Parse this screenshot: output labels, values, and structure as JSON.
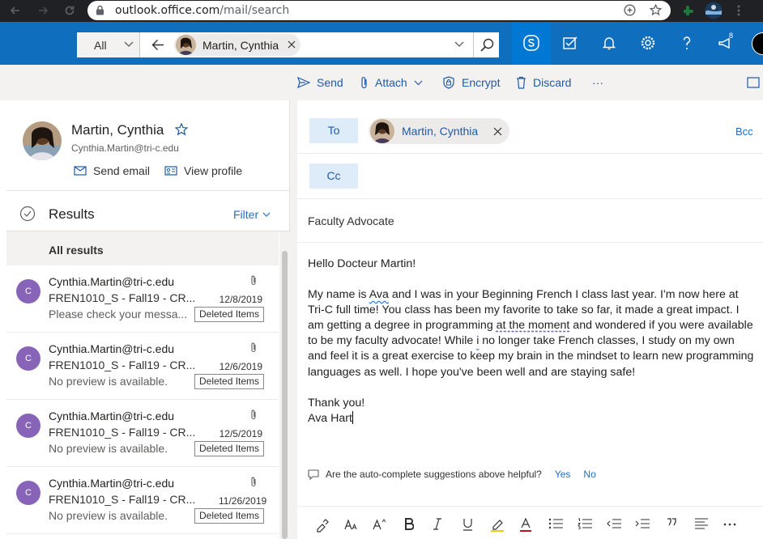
{
  "browser": {
    "url_host": "outlook.office.com",
    "url_path": "/mail/search"
  },
  "search": {
    "scope": "All",
    "chip_name": "Martin, Cynthia"
  },
  "suite": {
    "notification_count": "8"
  },
  "commands": {
    "send": "Send",
    "attach": "Attach",
    "encrypt": "Encrypt",
    "discard": "Discard",
    "more": "···"
  },
  "contact": {
    "name": "Martin, Cynthia",
    "email": "Cynthia.Martin@tri-c.edu",
    "send_email": "Send email",
    "view_profile": "View profile"
  },
  "results": {
    "title": "Results",
    "filter": "Filter",
    "all_results": "All results"
  },
  "messages": [
    {
      "initial": "C",
      "from": "Cynthia.Martin@tri-c.edu",
      "subject": "FREN1010_S - Fall19 - CR...",
      "date": "12/8/2019",
      "preview": "Please check your messa...",
      "folder": "Deleted Items"
    },
    {
      "initial": "C",
      "from": "Cynthia.Martin@tri-c.edu",
      "subject": "FREN1010_S - Fall19 - CR...",
      "date": "12/6/2019",
      "preview": "No preview is available.",
      "folder": "Deleted Items"
    },
    {
      "initial": "C",
      "from": "Cynthia.Martin@tri-c.edu",
      "subject": "FREN1010_S - Fall19 - CR...",
      "date": "12/5/2019",
      "preview": "No preview is available.",
      "folder": "Deleted Items"
    },
    {
      "initial": "C",
      "from": "Cynthia.Martin@tri-c.edu",
      "subject": "FREN1010_S - Fall19 - CR...",
      "date": "11/26/2019",
      "preview": "No preview is available.",
      "folder": "Deleted Items"
    }
  ],
  "compose": {
    "to_label": "To",
    "cc_label": "Cc",
    "bcc_label": "Bcc",
    "recipient": "Martin, Cynthia",
    "subject": "Faculty Advocate",
    "greeting": "Hello Docteur Martin!",
    "para1_a": "My name is ",
    "para1_ava": "Ava",
    "para1_b": " and I was in your Beginning French I class last year. I'm now here at Tri-C full time! You class has been my favorite to take so far, it made a great impact. I am getting a degree in programming ",
    "para1_moment": "at the moment",
    "para1_c": " and wondered if you were available to be my faculty advocate! While ",
    "para1_i": "i",
    "para1_d": " no longer take French classes, I study on my own and feel it is a great exercise to keep my brain in the mindset to learn new programming languages as well. I hope you've been well and are staying safe!",
    "closing": "Thank you!",
    "signature": "Ava Hart",
    "suggest_question": "Are the auto-complete suggestions above helpful?",
    "suggest_yes": "Yes",
    "suggest_no": "No"
  },
  "colors": {
    "suite_blue": "#106ebe",
    "accent": "#1f5aa6",
    "avatar_purple": "#8764b8"
  },
  "icons": [
    "lock-icon",
    "search-icon",
    "back-arrow-icon",
    "skype-icon",
    "todo-icon",
    "bell-icon",
    "gear-icon",
    "help-icon",
    "feedback-icon",
    "send-icon",
    "paperclip-icon",
    "shield-icon",
    "trash-icon",
    "star-icon",
    "mail-icon",
    "contact-card-icon",
    "check-circle-icon",
    "chevron-down-icon",
    "close-icon",
    "comment-icon"
  ]
}
